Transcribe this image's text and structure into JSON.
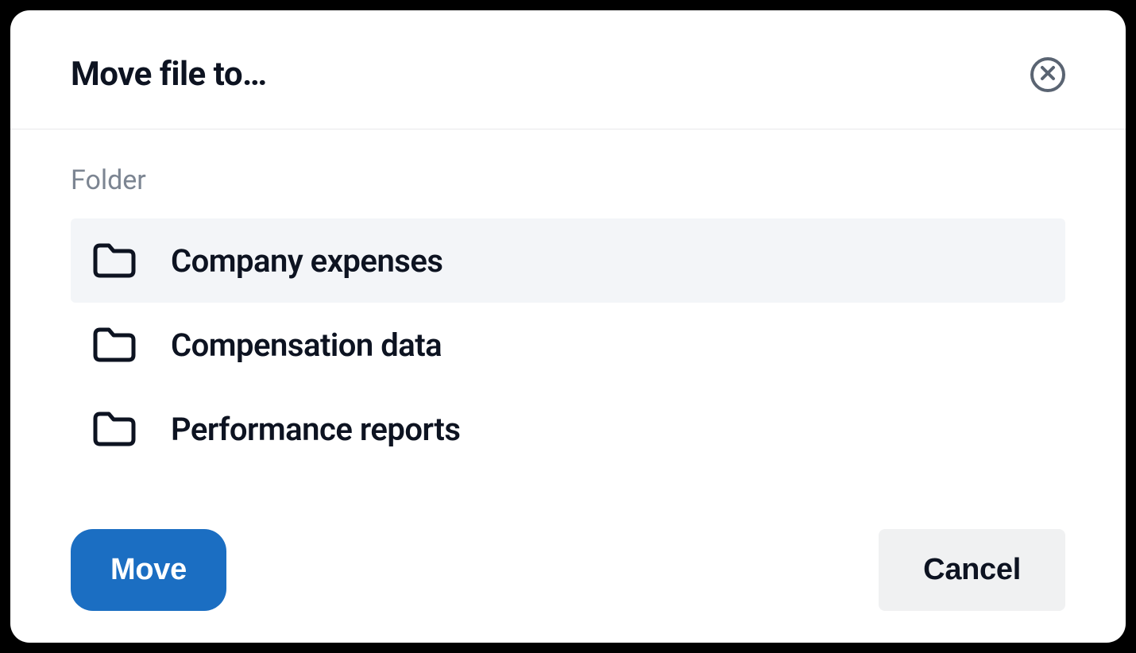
{
  "header": {
    "title": "Move file to…"
  },
  "body": {
    "section_label": "Folder",
    "folders": [
      {
        "name": "Company expenses",
        "selected": true
      },
      {
        "name": "Compensation data",
        "selected": false
      },
      {
        "name": "Performance reports",
        "selected": false
      }
    ]
  },
  "footer": {
    "move_label": "Move",
    "cancel_label": "Cancel"
  },
  "colors": {
    "primary": "#1b6ec2",
    "text": "#0d1321",
    "muted": "#7c8592",
    "selected_bg": "#f3f5f8",
    "cancel_bg": "#f0f1f2",
    "border": "#e8e9eb"
  }
}
